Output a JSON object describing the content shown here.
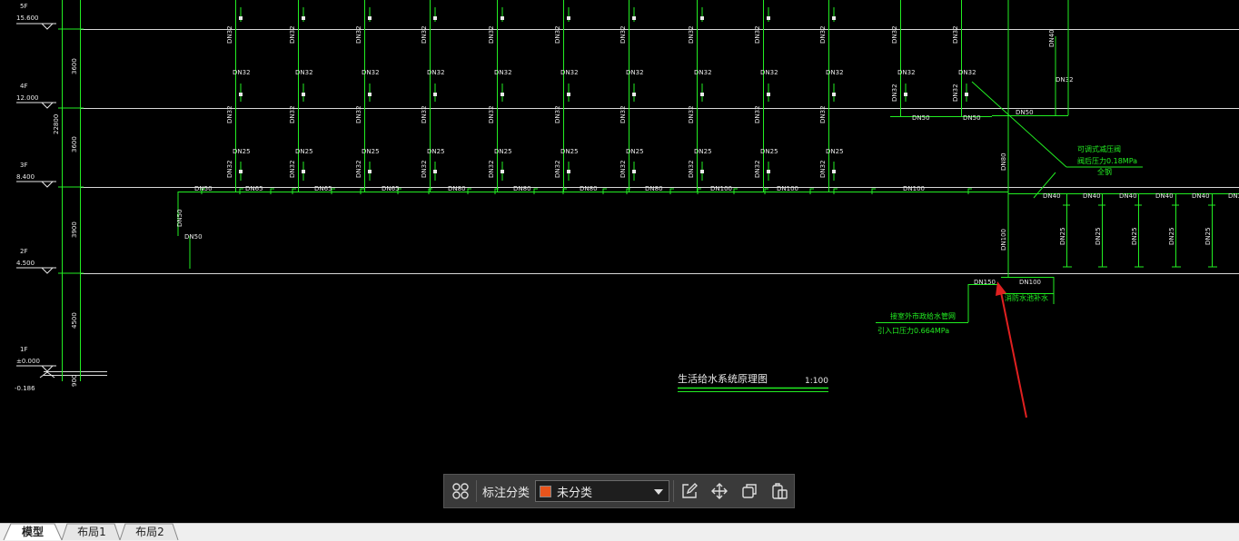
{
  "drawing": {
    "title": "生活给水系统原理图",
    "scale": "1:100",
    "floors": [
      {
        "name": "5F",
        "elevation": "15.600"
      },
      {
        "name": "4F",
        "elevation": "12.000"
      },
      {
        "name": "3F",
        "elevation": "8.400"
      },
      {
        "name": "2F",
        "elevation": "4.500"
      },
      {
        "name": "1F",
        "elevation": "±0.000"
      }
    ],
    "ground_level": "-0.186",
    "dim_labels": [
      "3600",
      "3600",
      "3900",
      "4500",
      "22800",
      "900"
    ],
    "riser_labels": {
      "upper": "DN32",
      "branch_4f": "DN32",
      "lower": "DN32",
      "branch_3f": "DN25",
      "bottom": "DN32"
    },
    "main_pipe_labels": [
      "DN50",
      "DN65",
      "DN65",
      "DN65",
      "DN80",
      "DN80",
      "DN80",
      "DN80",
      "DN100",
      "DN100",
      "DN100"
    ],
    "right_main_labels": [
      "DN40",
      "DN40",
      "DN40",
      "DN40",
      "DN40",
      "DN32"
    ],
    "right_branch_label": "DN25",
    "left_branch": {
      "top": "DN50",
      "bottom": "DN50"
    },
    "top_right_labels": [
      "DN50",
      "DN50",
      "DN50",
      "DN40",
      "DN32"
    ],
    "main_riser_labels": [
      "DN80",
      "DN100"
    ],
    "annotations": {
      "prv_title": "可调式减压阀",
      "prv_pressure": "阀后压力0.18MPa",
      "prv_note": "全钢",
      "inlet_title": "接室外市政给水管网",
      "inlet_pressure": "引入口压力0.664MPa",
      "inlet_pipe": "DN150",
      "fire_note": "消防水池补水",
      "fire_pipe": "DN100"
    },
    "colors": {
      "background": "#000000",
      "pipe": "#22ee22",
      "grid": "#e8e8e8",
      "arrow": "#e02020"
    }
  },
  "toolbar": {
    "grid_icon": "grid-icon",
    "category_label": "标注分类",
    "category_value": "未分类",
    "category_color": "#e8541c",
    "edit_icon": "edit-icon",
    "move_icon": "move-icon",
    "copy_icon": "copy-icon",
    "paste_icon": "paste-icon"
  },
  "tabs": [
    {
      "label": "模型",
      "active": true
    },
    {
      "label": "布局1",
      "active": false
    },
    {
      "label": "布局2",
      "active": false
    }
  ]
}
